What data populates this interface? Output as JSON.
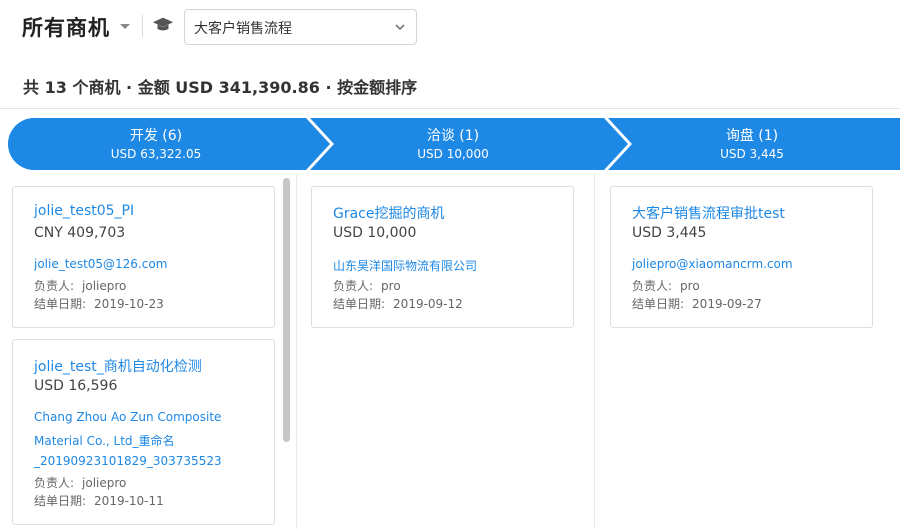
{
  "header": {
    "title": "所有商机",
    "pipeline_select": {
      "value": "大客户销售流程"
    }
  },
  "summary": {
    "count_prefix": "共",
    "count": "13",
    "count_suffix": "个商机",
    "amount_prefix": "金额",
    "amount": "USD 341,390.86",
    "sort": "按金额排序",
    "dot": "·"
  },
  "stages": [
    {
      "name": "开发 (6)",
      "amount": "USD 63,322.05"
    },
    {
      "name": "洽谈 (1)",
      "amount": "USD 10,000"
    },
    {
      "name": "询盘 (1)",
      "amount": "USD 3,445"
    }
  ],
  "labels": {
    "owner": "负责人:",
    "close_date": "结单日期:"
  },
  "columns": [
    {
      "cards": [
        {
          "name": "jolie_test05_PI",
          "amount": "CNY 409,703",
          "contact_lines": [
            "jolie_test05@126.com"
          ],
          "owner": "joliepro",
          "close_date": "2019-10-23"
        },
        {
          "name": "jolie_test_商机自动化检测",
          "amount": "USD 16,596",
          "contact_lines": [
            "Chang Zhou Ao Zun Composite",
            "Material Co., Ltd_重命名",
            "_20190923101829_303735523"
          ],
          "owner": "joliepro",
          "close_date": "2019-10-11"
        }
      ]
    },
    {
      "cards": [
        {
          "name": "Grace挖掘的商机",
          "amount": "USD 10,000",
          "contact_lines": [
            "山东昊洋国际物流有限公司"
          ],
          "owner": "pro",
          "close_date": "2019-09-12"
        }
      ]
    },
    {
      "cards": [
        {
          "name": "大客户销售流程审批test",
          "amount": "USD 3,445",
          "contact_lines": [
            "joliepro@xiaomancrm.com"
          ],
          "owner": "pro",
          "close_date": "2019-09-27"
        }
      ]
    }
  ],
  "colors": {
    "accent": "#1e88e5",
    "text": "#333333",
    "border": "#dedede"
  },
  "icons": {
    "title_caret": "caret-down-icon",
    "pipeline": "graduation-cap-icon",
    "select": "chevron-down-icon"
  }
}
